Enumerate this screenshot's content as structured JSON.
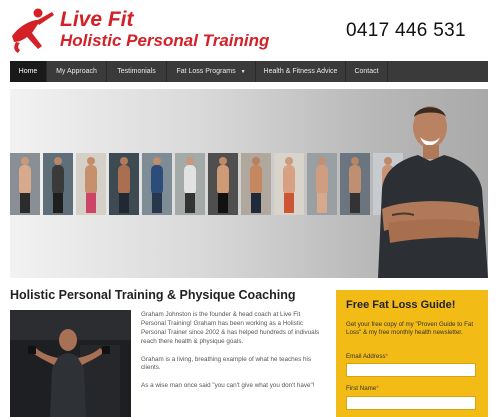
{
  "header": {
    "logo_line1": "Live Fit",
    "logo_line2": "Holistic Personal Training",
    "logo_icon": "runner-figure-icon",
    "phone": "0417 446 531",
    "brand_color": "#d32127"
  },
  "nav": {
    "items": [
      {
        "label": "Home",
        "active": true
      },
      {
        "label": "My Approach"
      },
      {
        "label": "Testimonials"
      },
      {
        "label": "Fat Loss Programs",
        "has_dropdown": true,
        "icon": "caret-down-icon"
      },
      {
        "label": "Health & Fitness Advice"
      },
      {
        "label": "Contact"
      }
    ]
  },
  "hero": {
    "thumbnail_count": 12,
    "thumbnail_description": "client transformation photos",
    "featured": "coach portrait, arms crossed"
  },
  "main": {
    "title": "Holistic Personal Training & Physique Coaching",
    "paragraphs": [
      "Graham Johnston is the founder & head coach at Live Fit Personal Training! Graham has been working as a Holistic Personal Trainer since 2002 & has helped hundreds of indivuals reach there health & physique goals.",
      "Graham is a living, breathing example of what he teaches his clients.",
      "As a wise man once said \"you can't give what you don't have\"!"
    ]
  },
  "sidebar": {
    "title": "Free Fat Loss Guide!",
    "description": "Get your free copy of my \"Proven Guide to Fat Loss\" & my free monthly health newsletter.",
    "email_label": "Email Address",
    "first_name_label": "First Name",
    "required_marker": "*",
    "email_value": "",
    "first_name_value": "",
    "background_color": "#f2bb16"
  }
}
